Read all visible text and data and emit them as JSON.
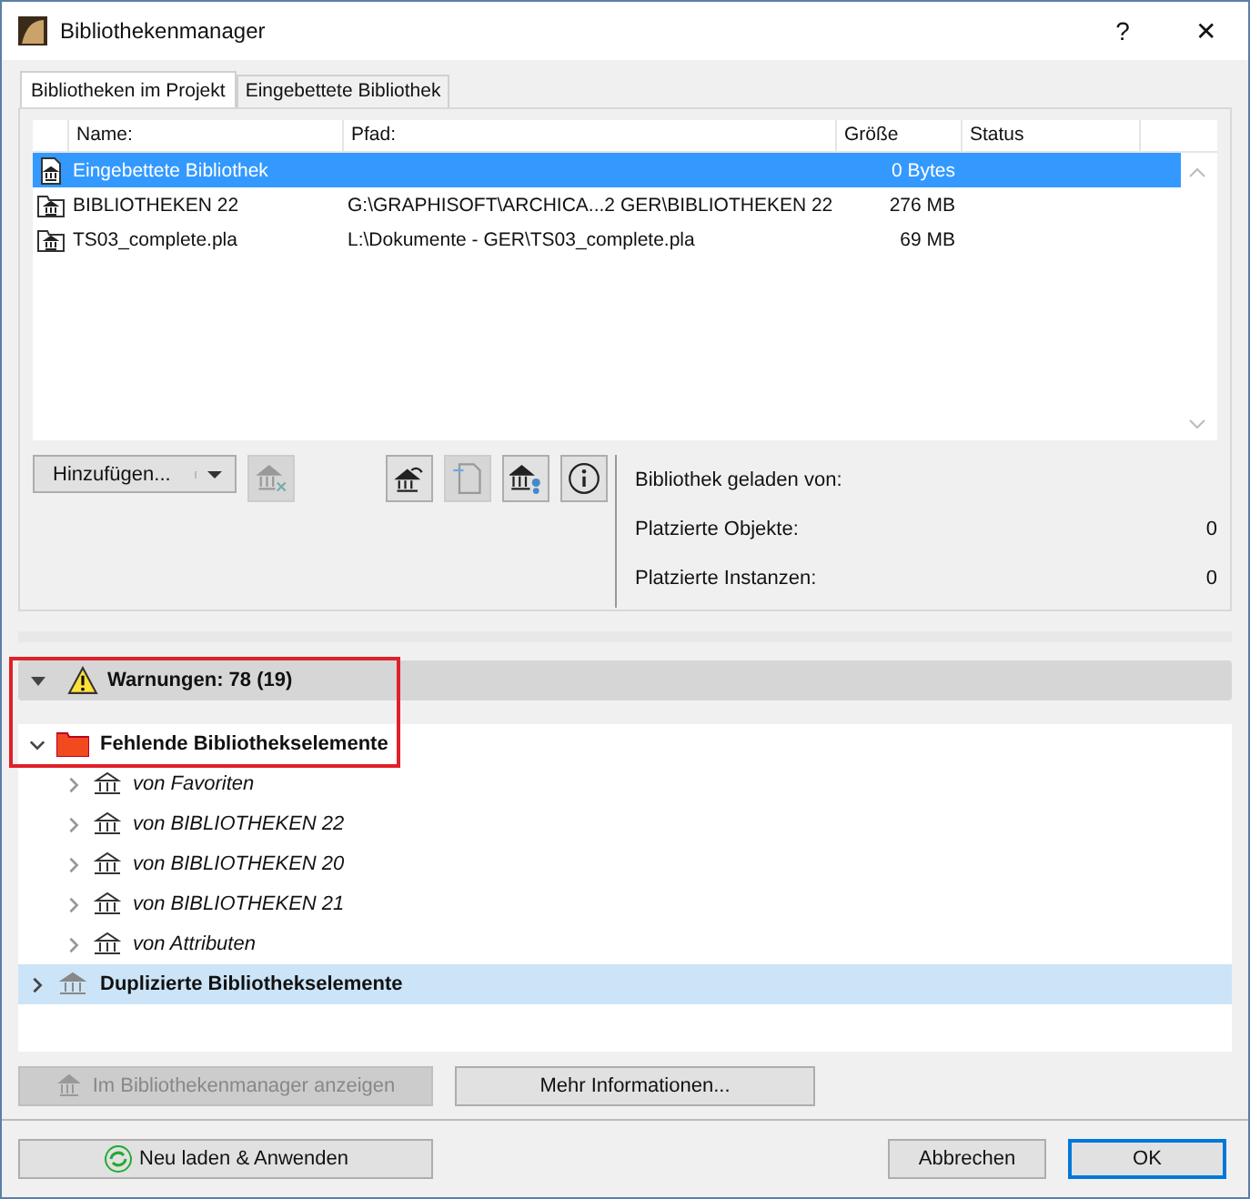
{
  "window": {
    "title": "Bibliothekenmanager",
    "help": "?",
    "close": "✕"
  },
  "tabs": [
    {
      "label": "Bibliotheken im Projekt",
      "selected": true
    },
    {
      "label": "Eingebettete Bibliothek",
      "selected": false
    }
  ],
  "table": {
    "columns": [
      "Name:",
      "Pfad:",
      "Größe",
      "Status"
    ],
    "rows": [
      {
        "name": "Eingebettete Bibliothek",
        "path": "",
        "size": "0 Bytes",
        "selected": true,
        "kind": "embedded"
      },
      {
        "name": "BIBLIOTHEKEN 22",
        "path": "G:\\GRAPHISOFT\\ARCHICA...2 GER\\BIBLIOTHEKEN 22",
        "size": "276 MB",
        "selected": false,
        "kind": "folder"
      },
      {
        "name": "TS03_complete.pla",
        "path": "L:\\Dokumente - GER\\TS03_complete.pla",
        "size": "69 MB",
        "selected": false,
        "kind": "folder"
      }
    ]
  },
  "add_button": "Hinzufügen...",
  "info": [
    {
      "label": "Bibliothek geladen von:"
    },
    {
      "label": "Platzierte Objekte:",
      "value": "0"
    },
    {
      "label": "Platzierte Instanzen:",
      "value": "0"
    }
  ],
  "warnings": {
    "label": "Warnungen: 78 (19)",
    "expanded": true
  },
  "tree": [
    {
      "label": "Fehlende Bibliothekselemente",
      "expanded": true,
      "selected": false,
      "children": [
        {
          "label": "von Favoriten"
        },
        {
          "label": "von BIBLIOTHEKEN 22"
        },
        {
          "label": "von BIBLIOTHEKEN 20"
        },
        {
          "label": "von BIBLIOTHEKEN 21"
        },
        {
          "label": "von Attributen"
        }
      ]
    },
    {
      "label": "Duplizierte Bibliothekselemente",
      "expanded": false,
      "selected": true
    }
  ],
  "show_button": {
    "label": "Im Bibliothekenmanager anzeigen",
    "disabled": true
  },
  "more_button": "Mehr Informationen...",
  "reload_button": "Neu laden & Anwenden",
  "cancel_button": "Abbrechen",
  "ok_button": "OK"
}
